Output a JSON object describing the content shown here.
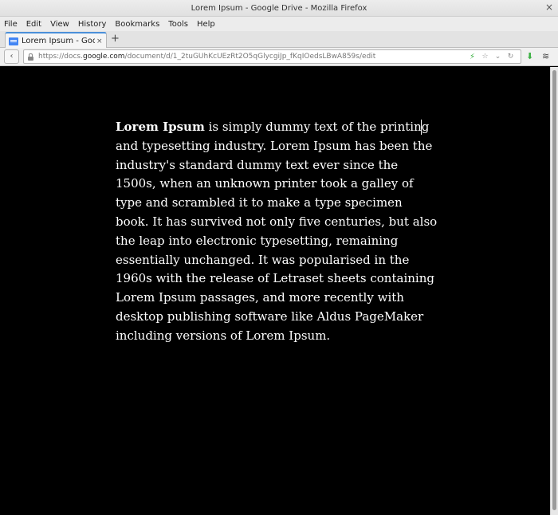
{
  "window": {
    "title": "Lorem Ipsum - Google Drive - Mozilla Firefox",
    "close_glyph": "×"
  },
  "menu": [
    "File",
    "Edit",
    "View",
    "History",
    "Bookmarks",
    "Tools",
    "Help"
  ],
  "tab": {
    "label": "Lorem Ipsum - Google ...",
    "close_glyph": "×",
    "new_tab_glyph": "+"
  },
  "nav": {
    "back_glyph": "‹",
    "url_prefix": "https://docs.",
    "url_domain": "google.com",
    "url_rest": "/document/d/1_2tuGUhKcUEzRt2O5qGlycgiJp_fKqIOedsLBwA859s/edit"
  },
  "document": {
    "bold_lead": "Lorem Ipsum",
    "body": " is simply dummy text of the printing and typesetting industry. Lorem Ipsum has been the industry's standard dummy text ever since the 1500s, when an unknown printer took a galley of type and scrambled it to make a type specimen book. It has survived not only five centuries, but also the leap into electronic typesetting, remaining essentially unchanged. It was popularised in the 1960s with the release of Letraset sheets containing Lorem Ipsum passages, and more recently with desktop publishing software like Aldus PageMaker including versions of Lorem Ipsum."
  },
  "icons": {
    "lock": "lock-icon",
    "bolt": "lightning-icon",
    "star": "star-icon",
    "dropdown": "chevron-down-icon",
    "reload": "reload-icon",
    "download": "download-icon",
    "pocket": "pocket-icon"
  },
  "colors": {
    "accent": "#4a90d9",
    "background": "#000000",
    "text": "#ffffff",
    "download": "#3cb043"
  }
}
